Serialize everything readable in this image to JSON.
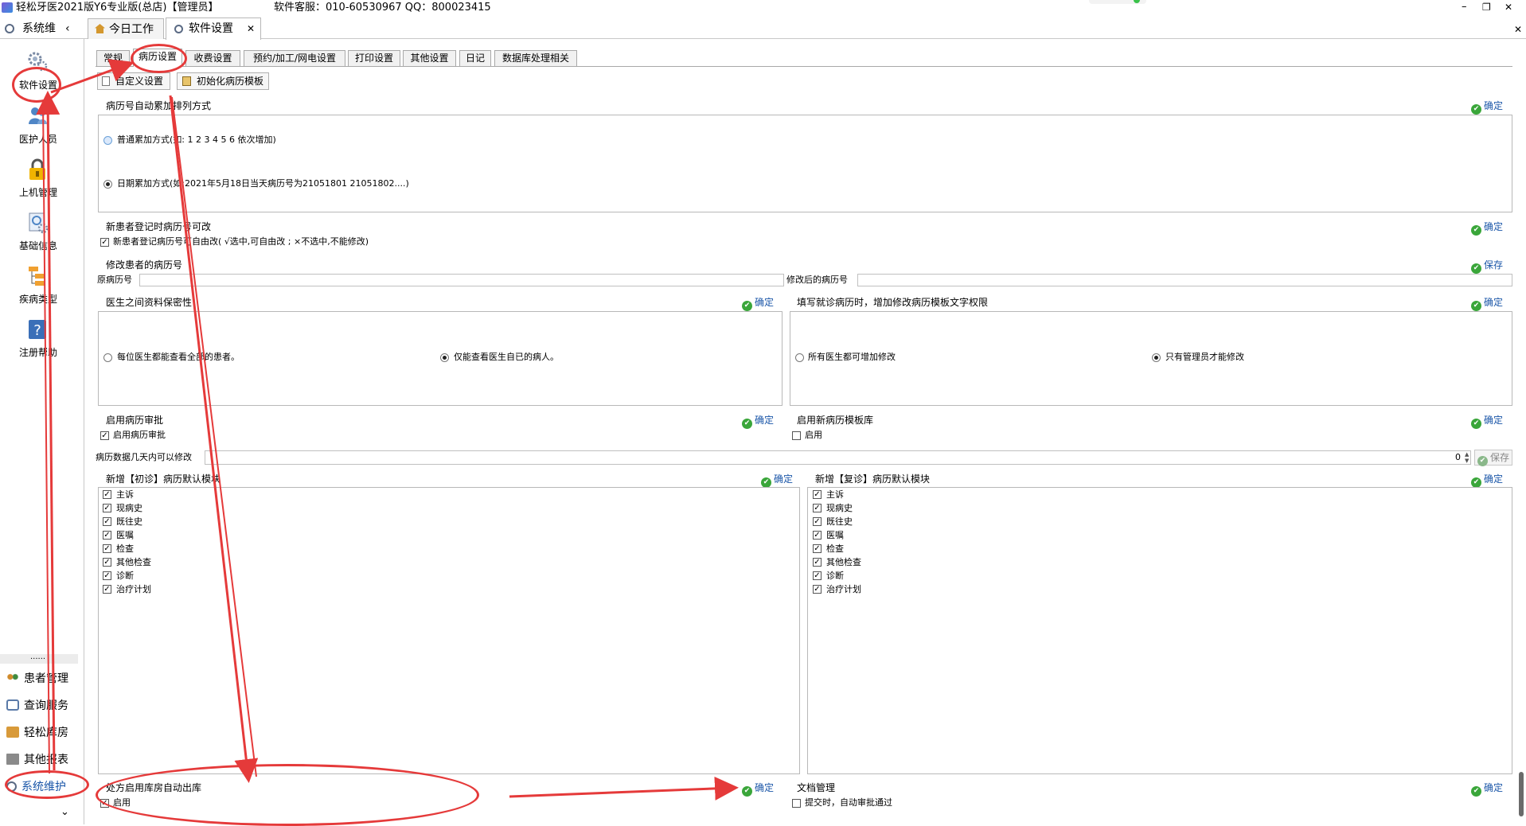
{
  "title_bar": {
    "title": "轻松牙医2021版Y6专业版(总店)【管理员】",
    "service": "软件客服：010-60530967 QQ：800023415",
    "controls": [
      "–",
      "❐",
      "✕"
    ]
  },
  "module_header": {
    "label": "系统维"
  },
  "doc_tabs": [
    {
      "label": "今日工作"
    },
    {
      "label": "软件设置",
      "close": "✕"
    }
  ],
  "close_x": "✕",
  "sidebar_tools": [
    {
      "label": "软件设置",
      "icon": "gears-icon"
    },
    {
      "label": "医护人员",
      "icon": "staff-icon"
    },
    {
      "label": "上机管理",
      "icon": "lock-icon"
    },
    {
      "label": "基础信息",
      "icon": "info-icon"
    },
    {
      "label": "疾病类型",
      "icon": "tree-icon"
    },
    {
      "label": "注册帮助",
      "icon": "help-icon"
    }
  ],
  "sidebar_splitter": "......",
  "sidebar_nav": [
    {
      "label": "患者管理",
      "active": false
    },
    {
      "label": "查询服务",
      "active": false
    },
    {
      "label": "轻松库房",
      "active": false
    },
    {
      "label": "其他报表",
      "active": false
    },
    {
      "label": "系统维护",
      "active": true
    }
  ],
  "sidebar_chevron": "⌄",
  "settings_tabs": [
    "常规",
    "病历设置",
    "收费设置",
    "预约/加工/网电设置",
    "打印设置",
    "其他设置",
    "日记",
    "数据库处理相关"
  ],
  "toolbar": {
    "custom": "自定义设置",
    "init": "初始化病历模板"
  },
  "confirm_label": "确定",
  "save_label": "保存",
  "sections": {
    "numbering": {
      "title": "病历号自动累加排列方式",
      "opt1": "普通累加方式(如: 1  2  3  4  5  6 依次增加)",
      "opt2": "日期累加方式(如:2021年5月18日当天病历号为21051801 21051802....)"
    },
    "editable": {
      "title": "新患者登记时病历号可改",
      "check": "新患者登记病历号可自由改( √选中,可自由改 ;  ×不选中,不能修改)"
    },
    "modify": {
      "title": "修改患者的病历号",
      "orig": "原病历号",
      "after": "修改后的病历号"
    },
    "privacy": {
      "title": "医生之间资料保密性",
      "opt1": "每位医生都能查看全部的患者。",
      "opt2": "仅能查看医生自已的病人。"
    },
    "template_perm": {
      "title": "填写就诊病历时，增加修改病历模板文字权限",
      "opt1": "所有医生都可增加修改",
      "opt2": "只有管理员才能修改"
    },
    "approval": {
      "title": "启用病历审批",
      "check": "启用病历审批"
    },
    "new_template_lib": {
      "title": "启用新病历模板库",
      "check": "启用"
    },
    "days": {
      "label": "病历数据几天内可以修改",
      "value": "0"
    },
    "first_visit": {
      "title": "新增【初诊】病历默认模块",
      "items": [
        "主诉",
        "现病史",
        "既往史",
        "医嘱",
        "检查",
        "其他检查",
        "诊断",
        "治疗计划"
      ]
    },
    "revisit": {
      "title": "新增【复诊】病历默认模块",
      "items": [
        "主诉",
        "现病史",
        "既往史",
        "医嘱",
        "检查",
        "其他检查",
        "诊断",
        "治疗计划"
      ]
    },
    "pharmacy": {
      "title": "处方启用库房自动出库",
      "check": "启用"
    },
    "docs": {
      "title": "文档管理",
      "check": "提交时，自动审批通过"
    }
  },
  "colors": {
    "annotation": "#e53a3a",
    "confirm_text": "#1a56a8",
    "ok_icon": "#3aa63a",
    "nav_active": "#1a56a8"
  }
}
